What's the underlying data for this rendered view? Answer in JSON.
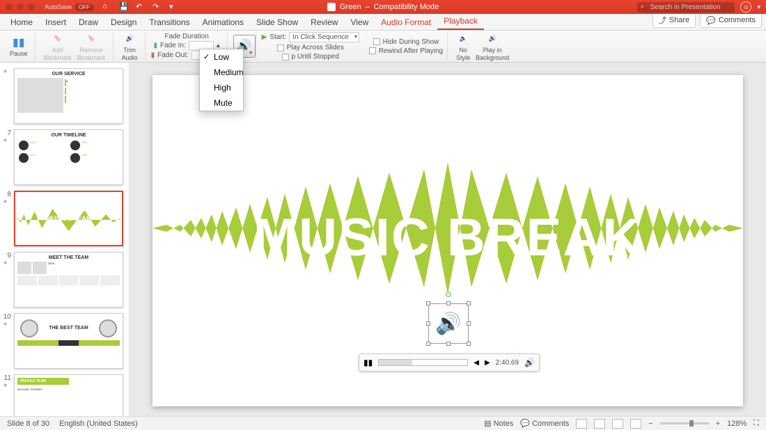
{
  "titlebar": {
    "autosave_label": "AutoSave",
    "autosave_state": "OFF",
    "doc_name": "Green",
    "mode": "Compatibility Mode",
    "search_placeholder": "Search in Presentation"
  },
  "tabs": {
    "items": [
      "Home",
      "Insert",
      "Draw",
      "Design",
      "Transitions",
      "Animations",
      "Slide Show",
      "Review",
      "View",
      "Audio Format",
      "Playback"
    ],
    "active": "Playback",
    "share": "Share",
    "comments": "Comments"
  },
  "ribbon": {
    "pause": "Pause",
    "add_bookmark_l1": "Add",
    "add_bookmark_l2": "Bookmark",
    "remove_bookmark_l1": "Remove",
    "remove_bookmark_l2": "Bookmark",
    "trim_l1": "Trim",
    "trim_l2": "Audio",
    "fade_title": "Fade Duration",
    "fade_in": "Fade In:",
    "fade_out": "Fade Out:",
    "start_label": "Start:",
    "start_value": "In Click Sequence",
    "play_across": "Play Across Slides",
    "loop": "p Until Stopped",
    "hide": "Hide During Show",
    "rewind": "Rewind After Playing",
    "no_style_l1": "No",
    "no_style_l2": "Style",
    "play_bg_l1": "Play in",
    "play_bg_l2": "Background"
  },
  "volume_menu": {
    "items": [
      "Low",
      "Medium",
      "High",
      "Mute"
    ],
    "checked": "Low"
  },
  "thumbs": [
    {
      "num": "",
      "title": "OUR SERVICE"
    },
    {
      "num": "7",
      "title": "OUR TIMELINE"
    },
    {
      "num": "8",
      "title": "MUSIC BREAK",
      "selected": true
    },
    {
      "num": "9",
      "title": "MEET THE TEAM"
    },
    {
      "num": "10",
      "title": "THE BEST TEAM"
    },
    {
      "num": "11",
      "title": "PROFILE TEAM"
    }
  ],
  "slide": {
    "title": "MUSIC BREAK"
  },
  "player": {
    "time": "2:40.69"
  },
  "status": {
    "slide_info": "Slide 8 of 30",
    "lang": "English (United States)",
    "notes": "Notes",
    "comments": "Comments",
    "zoom": "128%"
  }
}
